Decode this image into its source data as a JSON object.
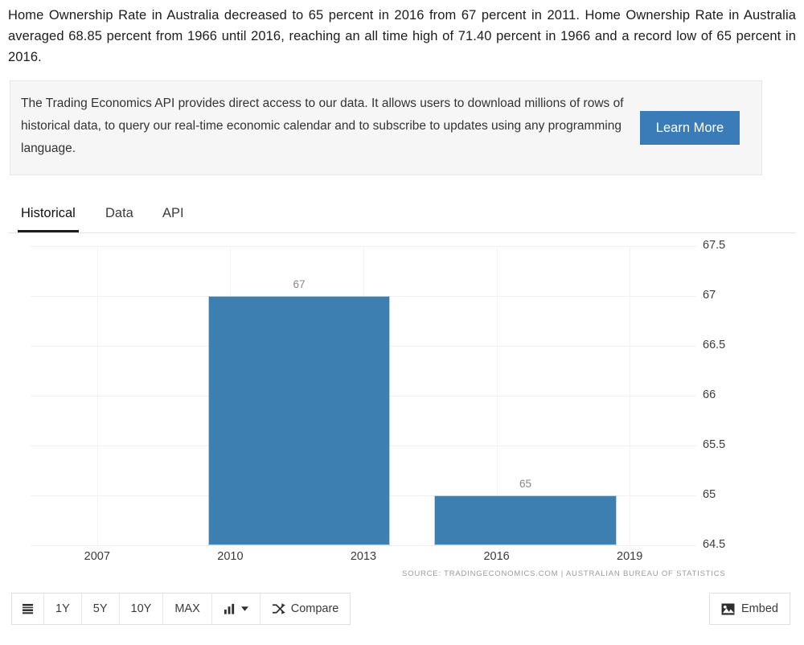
{
  "intro": {
    "paragraph": "Home Ownership Rate in Australia decreased to 65 percent in 2016 from 67 percent in 2011. Home Ownership Rate in Australia averaged 68.85 percent from 1966 until 2016, reaching an all time high of 71.40 percent in 1966 and a record low of 65 percent in 2016."
  },
  "promo": {
    "text": "The Trading Economics API provides direct access to our data. It allows users to download millions of rows of historical data, to query our real-time economic calendar and to subscribe to updates using any programming language.",
    "button_label": "Learn More",
    "button_color": "#3a7cb8"
  },
  "tabs": [
    {
      "label": "Historical",
      "active": true
    },
    {
      "label": "Data",
      "active": false
    },
    {
      "label": "API",
      "active": false
    }
  ],
  "chart_data": {
    "type": "bar",
    "title": "",
    "subtitle": "",
    "xlabel": "",
    "ylabel": "",
    "categories": [
      "2011",
      "2016"
    ],
    "values": [
      67,
      65
    ],
    "value_labels": [
      "67",
      "65"
    ],
    "ylim": [
      64.5,
      67.5
    ],
    "yticks": [
      "67.5",
      "67",
      "66.5",
      "66",
      "65.5",
      "65",
      "64.5"
    ],
    "ytick_values": [
      67.5,
      67,
      66.5,
      66,
      65.5,
      65,
      64.5
    ],
    "xticks": [
      "2007",
      "2010",
      "2013",
      "2016",
      "2019"
    ],
    "xtick_values": [
      2007,
      2010,
      2013,
      2016,
      2019
    ],
    "xlim": [
      2005.5,
      2020.5
    ],
    "grid": true,
    "legend": "none",
    "bar_color": "#3d7fb1",
    "source": "SOURCE: TRADINGECONOMICS.COM  |  AUSTRALIAN BUREAU OF STATISTICS"
  },
  "toolbar": {
    "menu_icon": "list-icon",
    "ranges": [
      "1Y",
      "5Y",
      "10Y",
      "MAX"
    ],
    "charttype_icon": "bar-chart-icon",
    "charttype_caret": "chevron-down-icon",
    "compare_icon": "shuffle-icon",
    "compare_label": "Compare",
    "embed_icon": "image-icon",
    "embed_label": "Embed"
  }
}
